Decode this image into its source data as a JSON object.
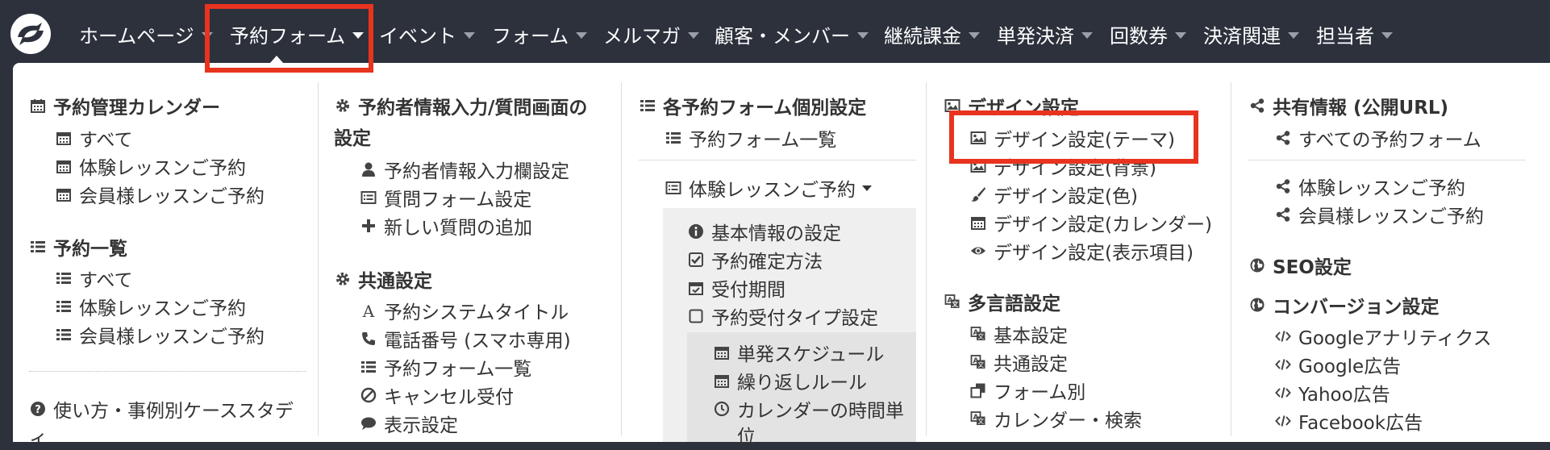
{
  "nav": {
    "items": [
      {
        "label": "ホームページ"
      },
      {
        "label": "予約フォーム"
      },
      {
        "label": "イベント"
      },
      {
        "label": "フォーム"
      },
      {
        "label": "メルマガ"
      },
      {
        "label": "顧客・メンバー"
      },
      {
        "label": "継続課金"
      },
      {
        "label": "単発決済"
      },
      {
        "label": "回数券"
      },
      {
        "label": "決済関連"
      },
      {
        "label": "担当者"
      }
    ],
    "active": "予約フォーム",
    "highlight_color": "#e8331e"
  },
  "col1": {
    "calendar": {
      "header": "予約管理カレンダー",
      "items": [
        "すべて",
        "体験レッスンご予約",
        "会員様レッスンご予約"
      ]
    },
    "list": {
      "header": "予約一覧",
      "items": [
        "すべて",
        "体験レッスンご予約",
        "会員様レッスンご予約"
      ]
    },
    "help": "使い方・事例別ケーススタデ",
    "help_wrap": "ィ"
  },
  "col2": {
    "input": {
      "header_line1": "予約者情報入力/質問画面の",
      "header_line2": "設定",
      "items": [
        "予約者情報入力欄設定",
        "質問フォーム設定",
        "新しい質問の追加"
      ]
    },
    "common": {
      "header": "共通設定",
      "items": [
        "予約システムタイトル",
        "電話番号 (スマホ専用)",
        "予約フォーム一覧",
        "キャンセル受付",
        "表示設定"
      ]
    }
  },
  "col3": {
    "header": "各予約フォーム個別設定",
    "list_item": "予約フォーム一覧",
    "dropdown": "体験レッスンご予約",
    "sub_items": [
      "基本情報の設定",
      "予約確定方法",
      "受付期間",
      "予約受付タイプ設定"
    ],
    "sub_sub_items": [
      "単発スケジュール",
      "繰り返しルール",
      "カレンダーの時間単"
    ],
    "sub_sub_wrap": "位"
  },
  "col4": {
    "design": {
      "header": "デザイン設定",
      "items": [
        "デザイン設定(テーマ)",
        "デザイン設定(背景)",
        "デザイン設定(色)",
        "デザイン設定(カレンダー)",
        "デザイン設定(表示項目)"
      ]
    },
    "lang": {
      "header": "多言語設定",
      "items": [
        "基本設定",
        "共通設定",
        "フォーム別",
        "カレンダー・検索"
      ]
    }
  },
  "col5": {
    "share": {
      "header": "共有情報 (公開URL)",
      "all": "すべての予約フォーム",
      "items": [
        "体験レッスンご予約",
        "会員様レッスンご予約"
      ]
    },
    "seo": "SEO設定",
    "conversion": {
      "header": "コンバージョン設定",
      "items": [
        "Googleアナリティクス",
        "Google広告",
        "Yahoo広告",
        "Facebook広告"
      ]
    }
  }
}
